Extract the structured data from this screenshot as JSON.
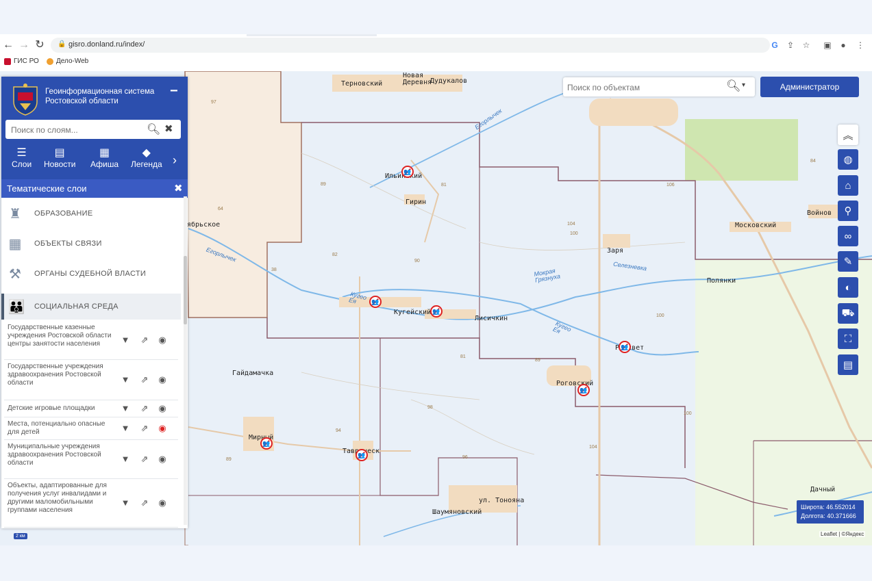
{
  "browser": {
    "url": "gisro.donland.ru/index/",
    "bookmarks": [
      {
        "label": "ГИС РО",
        "color": "#c8102e"
      },
      {
        "label": "Дело-Web",
        "color": "#f0a030"
      }
    ]
  },
  "app": {
    "title": "Геоинформационная система Ростовской области",
    "layer_search_placeholder": "Поиск по слоям...",
    "nav_tabs": [
      {
        "label": "Слои",
        "icon": "menu-icon"
      },
      {
        "label": "Новости",
        "icon": "newspaper-icon"
      },
      {
        "label": "Афиша",
        "icon": "calendar-icon"
      },
      {
        "label": "Легенда",
        "icon": "layers-icon"
      }
    ],
    "section_title": "Тематические слои",
    "categories": [
      {
        "label": "ОБРАЗОВАНИЕ",
        "icon": "education-icon"
      },
      {
        "label": "ОБЪЕКТЫ СВЯЗИ",
        "icon": "building-icon"
      },
      {
        "label": "ОРГАНЫ СУДЕБНОЙ ВЛАСТИ",
        "icon": "gavel-icon"
      },
      {
        "label": "СОЦИАЛЬНАЯ СРЕДА",
        "icon": "people-icon"
      }
    ],
    "layers": [
      {
        "label": "Государственные казенные учреждения Ростовской области центры занятости населения",
        "eye_active": false
      },
      {
        "label": "Государственные учреждения здравоохранения Ростовской области",
        "eye_active": false
      },
      {
        "label": "Детские игровые площадки",
        "eye_active": false
      },
      {
        "label": "Места, потенциально опасные для детей",
        "eye_active": true
      },
      {
        "label": "Муниципальные учреждения здравоохранения Ростовской области",
        "eye_active": false
      },
      {
        "label": "Объекты, адаптированные для получения услуг инвалидами и другими маломобильными группами населения",
        "eye_active": false
      }
    ],
    "object_search_placeholder": "Поиск по объектам",
    "admin_label": "Администратор",
    "right_toolbar": [
      "chevrons-up-icon",
      "globe-icon",
      "home-icon",
      "location-pin-icon",
      "link-icon",
      "ruler-icon",
      "world-icon",
      "car-icon",
      "fullscreen-icon",
      "comment-icon"
    ],
    "coords": {
      "lat_label": "Широта:",
      "lat": "46.552014",
      "lon_label": "Долгота:",
      "lon": "40.371666"
    },
    "attribution": "Leaflet | ©Яндекс",
    "scale": "2 км"
  },
  "map": {
    "places": [
      {
        "name": "Терновский"
      },
      {
        "name": "Новая Деревня"
      },
      {
        "name": "Дудукалов"
      },
      {
        "name": "Ильинский"
      },
      {
        "name": "Гирин"
      },
      {
        "name": "ябрьское"
      },
      {
        "name": "Кугейский"
      },
      {
        "name": "Лисичкин"
      },
      {
        "name": "Заря"
      },
      {
        "name": "Московский"
      },
      {
        "name": "Войнов"
      },
      {
        "name": "Полянки"
      },
      {
        "name": "Гайдамачка"
      },
      {
        "name": "Роговский"
      },
      {
        "name": "Рассвет"
      },
      {
        "name": "Мирный"
      },
      {
        "name": "Таврическ"
      },
      {
        "name": "ул. Тонояна"
      },
      {
        "name": "Шаумяновский"
      },
      {
        "name": "Дачный"
      }
    ],
    "rivers": [
      {
        "name": "Егорлычек"
      },
      {
        "name": "Кугео Ея"
      },
      {
        "name": "Мокрая Грязнуха"
      },
      {
        "name": "Селезневка"
      },
      {
        "name": "Кугео Ея "
      },
      {
        "name": "Егорлычек "
      }
    ],
    "elevations": [
      "97",
      "89",
      "81",
      "64",
      "82",
      "90",
      "104",
      "100",
      "106",
      "38",
      "100",
      "81",
      "89",
      "98",
      "94",
      "96",
      "104",
      "89",
      "100",
      "84"
    ]
  }
}
